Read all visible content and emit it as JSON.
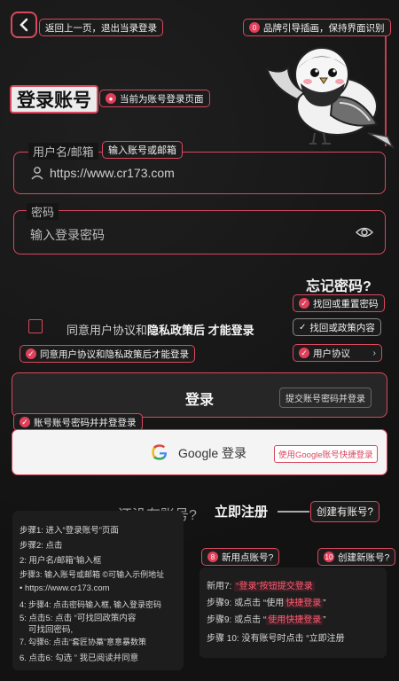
{
  "header": {
    "back_annotation": "返回上一页，退出当录登录",
    "brand_annotation": "品牌引导插画，保持界面识别",
    "brand_annotation_num": "0"
  },
  "title": {
    "text": "登录账号",
    "annotation": "当前为账号登录页面"
  },
  "username": {
    "label": "用户名/邮箱",
    "annotation": "输入账号或邮箱",
    "value": "https://www.cr173.com"
  },
  "password": {
    "label": "密码",
    "placeholder": "输入登录密码"
  },
  "forgot": {
    "text": "忘记密码?",
    "annotation_1": "找回或重置密码",
    "annotation_2": "找回或政策内容"
  },
  "agreement": {
    "text_prefix": "同意用户协议和",
    "text_bold": "隐私政策后 才能登录",
    "annotation": "同意用户协议和隐私政策后才能登录",
    "right_tag": "用户协议"
  },
  "login": {
    "label": "登录",
    "inline_tag": "提交账号密码并登录",
    "annotation": "账号账号密码并并登登录"
  },
  "google": {
    "label": "Google 登录",
    "tag": "使用Google账号快捷登录"
  },
  "register": {
    "prompt": "还没有账号?",
    "link": "立即注册",
    "annotation": "创建有账号?"
  },
  "steps_left": [
    "步骤1: 进入“登录账号”页面",
    "步骤2: 点击",
    "2: 用户名/邮箱”输入框",
    "步骤3: 输入账号或邮箱 ©可输入示例地址",
    "• https://www.cr173.com",
    "4: 步骤4: 点击密码输入框, 输入登录密码",
    "5: 点击5: 点击 “可找回政策内容",
    "可找回密码,",
    "7. 勾骤6: 点击“套匠协藁”意意暴数策",
    "6. 点击6: 勾选 ” 我已阅读并同意"
  ],
  "right_panel": {
    "tag_8": "新用点账号?",
    "tag_8_num": "8",
    "tag_10": "创建新账号?",
    "tag_10_num": "10",
    "lines": [
      {
        "pre": "新用7: ",
        "hl": "“登录”按钮提交登录",
        "post": ""
      },
      {
        "pre": "步骤9: 或点击 “使用",
        "hl": "快捷登录",
        "post": "”"
      },
      {
        "pre": "步骤9:   或点击 “",
        "hl": "使用快捷登录",
        "post": "”"
      },
      {
        "pre": "步骤 10: 没有账号时点击 “立即注册",
        "hl": "",
        "post": ""
      }
    ]
  },
  "colors": {
    "accent": "#d9485e",
    "background": "#141414"
  }
}
